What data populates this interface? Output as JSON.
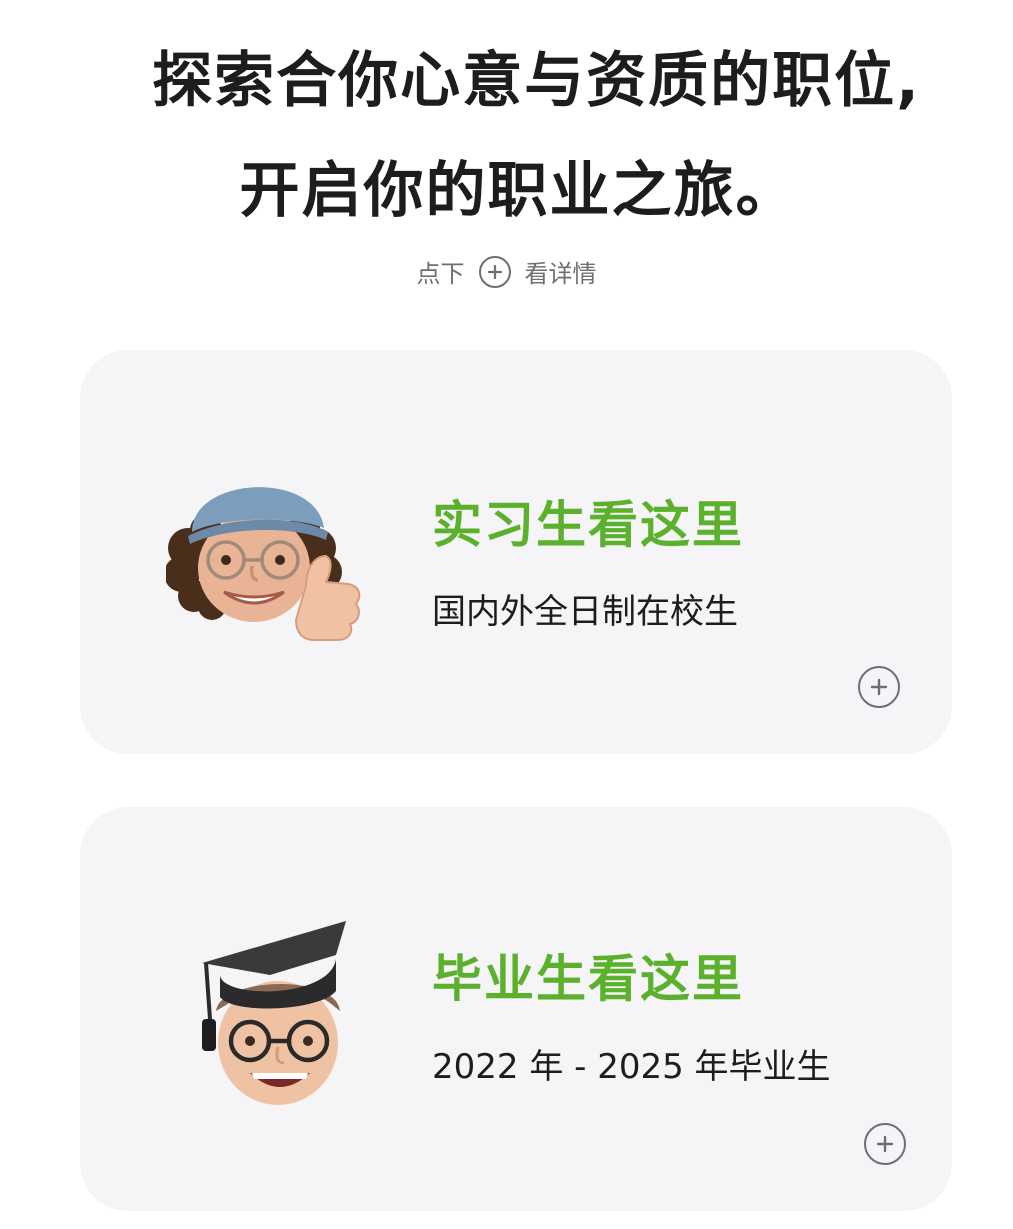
{
  "header": {
    "line1": "探索合你心意与资质的职位,",
    "line2": "开启你的职业之旅。",
    "hint_before": "点下",
    "hint_after": "看详情"
  },
  "cards": [
    {
      "title": "实习生看这里",
      "subtitle": "国内外全日制在校生"
    },
    {
      "title": "毕业生看这里",
      "subtitle": "2022 年 - 2025 年毕业生"
    }
  ],
  "colors": {
    "accent_green": "#5bb02c",
    "card_bg": "#f5f5f7",
    "text_dark": "#1d1d1f",
    "text_gray": "#6e6e73"
  },
  "icons": [
    "plus-circle-icon",
    "intern-memoji-avatar",
    "graduate-memoji-avatar"
  ]
}
